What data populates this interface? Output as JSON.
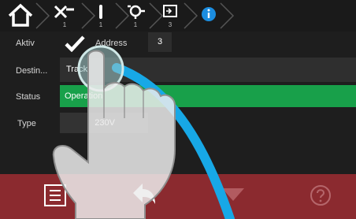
{
  "breadcrumb": {
    "items": [
      {
        "icon": "home-icon",
        "num": ""
      },
      {
        "icon": "wrench-cross-icon",
        "num": "1"
      },
      {
        "icon": "cable-icon",
        "num": "1"
      },
      {
        "icon": "gear-cycle-icon",
        "num": "1"
      },
      {
        "icon": "device-panel-icon",
        "num": "3"
      },
      {
        "icon": "info-icon",
        "num": ""
      }
    ]
  },
  "form": {
    "active_label": "Aktiv",
    "address_label": "Address",
    "address_value": "3",
    "destination_label": "Destin...",
    "destination_value": "Track",
    "status_label": "Status",
    "status_value": "Operation",
    "type_label": "Type",
    "type_value": "230V"
  },
  "bottom_bar": {
    "icons": [
      "list-icon",
      "back-icon",
      "triangle-icon",
      "help-icon"
    ]
  },
  "colors": {
    "status_green": "#18a04a",
    "bottom_red": "#8b2a2f",
    "info_blue": "#1b8de0",
    "gesture_blue": "#17a8e6"
  }
}
